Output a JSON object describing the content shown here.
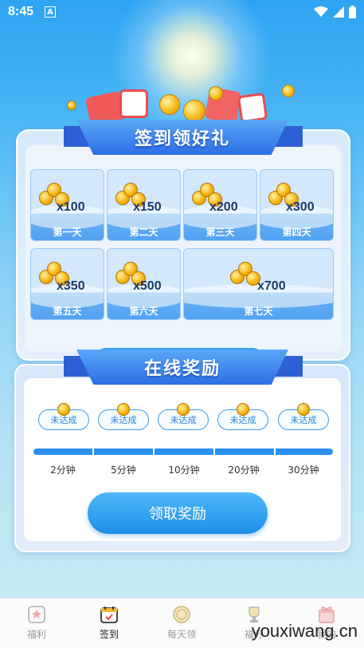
{
  "status_bar": {
    "time": "8:45",
    "notification": "A"
  },
  "signin_card": {
    "title": "签到领好礼",
    "days": [
      {
        "label": "第一天",
        "amount": "x100"
      },
      {
        "label": "第二天",
        "amount": "x150"
      },
      {
        "label": "第三天",
        "amount": "x200"
      },
      {
        "label": "第四天",
        "amount": "x300"
      },
      {
        "label": "第五天",
        "amount": "x350"
      },
      {
        "label": "第六天",
        "amount": "x500"
      },
      {
        "label": "第七天",
        "amount": "x700"
      }
    ]
  },
  "online_card": {
    "title": "在线奖励",
    "milestones": [
      {
        "status": "未达成",
        "time": "2分钟"
      },
      {
        "status": "未达成",
        "time": "5分钟"
      },
      {
        "status": "未达成",
        "time": "10分钟"
      },
      {
        "status": "未达成",
        "time": "20分钟"
      },
      {
        "status": "未达成",
        "time": "30分钟"
      }
    ],
    "claim_label": "领取奖励"
  },
  "bottom_nav": {
    "items": [
      {
        "label": "福利",
        "icon": "star-icon"
      },
      {
        "label": "签到",
        "icon": "calendar-icon"
      },
      {
        "label": "每天领",
        "icon": "coin-icon"
      },
      {
        "label": "福分",
        "icon": "trophy-icon"
      },
      {
        "label": "我的",
        "icon": "gift-icon"
      }
    ],
    "active": "签到"
  },
  "watermark": "youxiwang.cn",
  "colors": {
    "primary": "#2b8ff0",
    "ribbon": "#2d6fe6",
    "coin": "#f6b512"
  }
}
